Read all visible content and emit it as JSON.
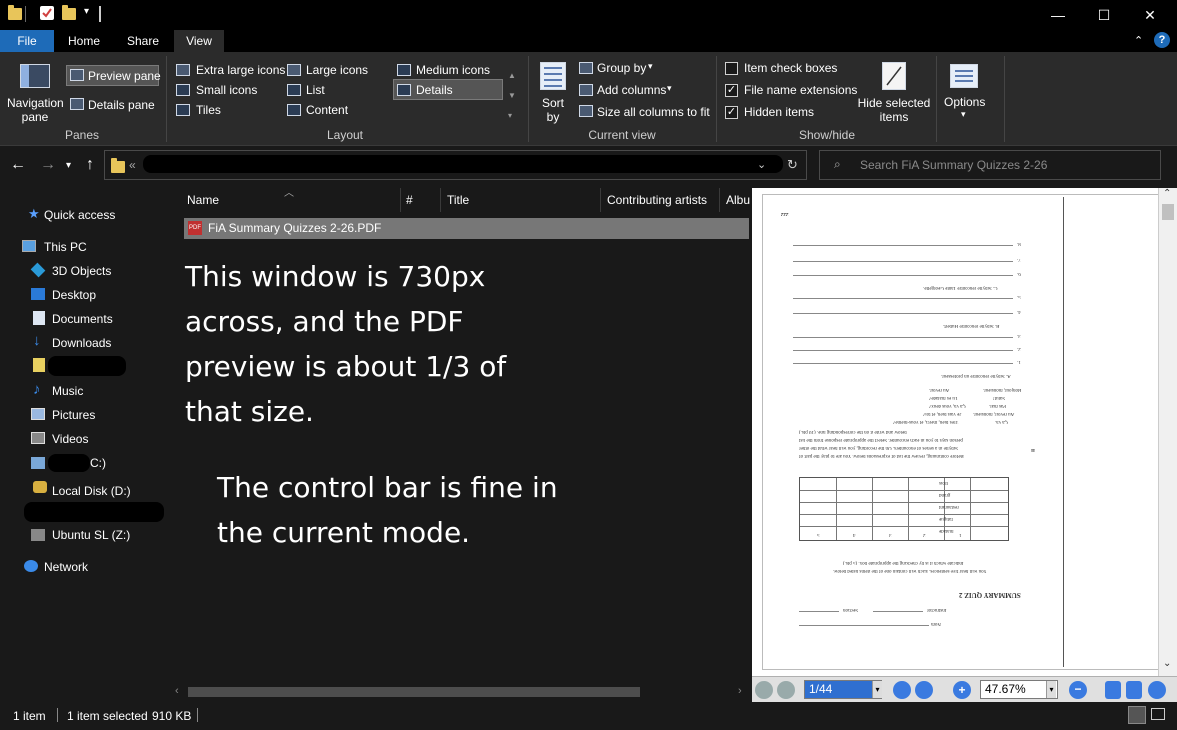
{
  "window": {
    "minimize": "—",
    "maximize": "☐",
    "close": "✕"
  },
  "ribbon_tabs": [
    "File",
    "Home",
    "Share",
    "View"
  ],
  "ribbon": {
    "panes": {
      "navigation_pane": "Navigation pane",
      "preview_pane": "Preview pane",
      "details_pane": "Details pane",
      "group_label": "Panes"
    },
    "layout": {
      "extra_large_icons": "Extra large icons",
      "large_icons": "Large icons",
      "medium_icons": "Medium icons",
      "small_icons": "Small icons",
      "list": "List",
      "details": "Details",
      "tiles": "Tiles",
      "content": "Content",
      "group_label": "Layout"
    },
    "current_view": {
      "sort_by": "Sort by",
      "group_by": "Group by",
      "add_columns": "Add columns",
      "size_all_columns": "Size all columns to fit",
      "group_label": "Current view"
    },
    "show_hide": {
      "item_check_boxes": "Item check boxes",
      "item_check_boxes_checked": false,
      "file_name_extensions": "File name extensions",
      "file_name_extensions_checked": true,
      "hidden_items": "Hidden items",
      "hidden_items_checked": true,
      "hide_selected_items": "Hide selected items",
      "group_label": "Show/hide"
    },
    "options": "Options",
    "help": "?"
  },
  "address": {
    "prefix": "«",
    "search_placeholder": "Search FiA Summary Quizzes 2-26"
  },
  "nav": {
    "quick_access": "Quick access",
    "this_pc": "This PC",
    "objects_3d": "3D Objects",
    "desktop": "Desktop",
    "documents": "Documents",
    "downloads": "Downloads",
    "music": "Music",
    "pictures": "Pictures",
    "videos": "Videos",
    "drive_c_suffix": "C:)",
    "local_disk_d": "Local Disk (D:)",
    "ubuntu": "Ubuntu SL (Z:)",
    "network": "Network"
  },
  "columns": [
    "Name",
    "#",
    "Title",
    "Contributing artists",
    "Albu"
  ],
  "files": [
    {
      "icon": "PDF",
      "name": "FiA Summary Quizzes 2-26.PDF"
    }
  ],
  "annotations": {
    "note1": [
      "This window is 730px",
      "across, and the PDF",
      "preview is about 1/3 of",
      "that size."
    ],
    "note2": [
      "The control bar is fine in",
      "the current mode."
    ]
  },
  "preview": {
    "page_field": "1/44",
    "zoom_field": "47.67%",
    "page_text": {
      "title": "SUMMARY QUIZ 2",
      "name": "Nom",
      "instructor": "Instructor",
      "section": "Section",
      "q1": "You will hear five sentences. Each will contain one of the items listed below.",
      "q1b": "Indicate which it is by checking the appropriate box. (5 pts.)",
      "table_rows": [
        "malade",
        "fatigué",
        "restaurant",
        "grand",
        "trois"
      ],
      "table_cols": [
        "1",
        "2",
        "3",
        "4",
        "5"
      ],
      "q2": "Before continuing, review the list of expressions below. You are to play the part of",
      "q2b": "Sibylle in a series of encounters. On the recording, you will hear what the other",
      "q2c": "person says to you in each encounter. Select the appropriate response from the list",
      "q2d": "below and write it on the corresponding line. (10 pts.)",
      "exprs": [
        "Ça va.",
        "Au revoir, monsieur.",
        "Pas mal.",
        "Salut!",
        "Bonjour, monsieur."
      ],
      "exprs2": [
        "Très bien, merci, et vous-même?",
        "Je vais bien, et toi?",
        "Ça va, vous deux?",
        "Tu es malade?",
        "Au revoir."
      ],
      "section_a": "A. Sibylle rencontre un professeur.",
      "section_b": "B. Sibylle rencontre Hubert.",
      "section_c": "C. Sibylle rencontre Tante Georgette.",
      "nums": [
        "1.",
        "2.",
        "3.",
        "4.",
        "5.",
        "6.",
        "7.",
        "8."
      ],
      "page_no": "222",
      "exercise_no": "II"
    }
  },
  "status": {
    "items": "1 item",
    "selected": "1 item selected",
    "size": "910 KB"
  }
}
